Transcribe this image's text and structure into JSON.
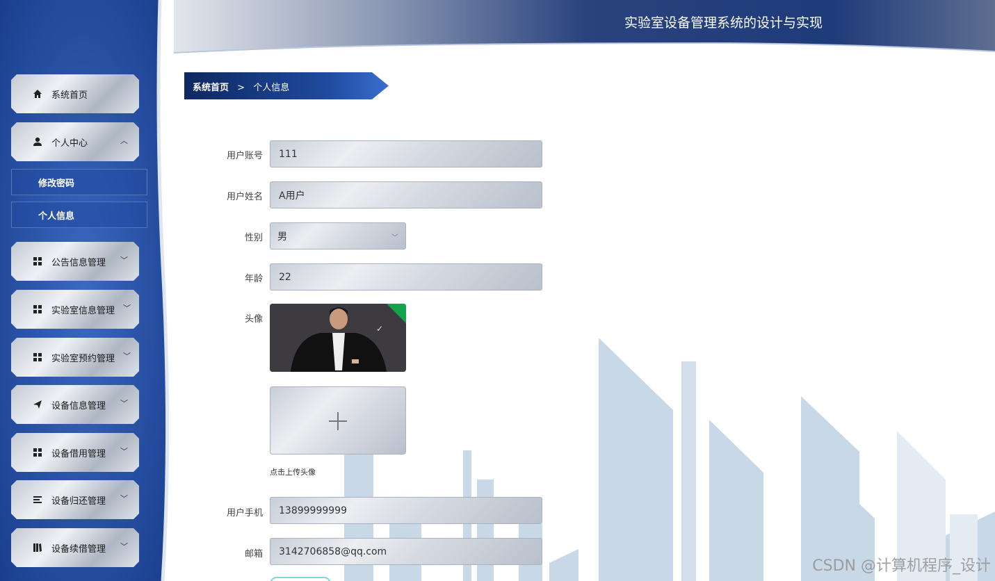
{
  "app": {
    "title": "实验室设备管理系统的设计与实现"
  },
  "breadcrumb": {
    "home": "系统首页",
    "separator": ">",
    "current": "个人信息"
  },
  "sidebar": {
    "items": [
      {
        "label": "系统首页",
        "icon": "home-icon"
      },
      {
        "label": "个人中心",
        "icon": "user-icon",
        "expanded": true
      },
      {
        "label": "公告信息管理",
        "icon": "grid-icon"
      },
      {
        "label": "实验室信息管理",
        "icon": "grid-icon"
      },
      {
        "label": "实验室预约管理",
        "icon": "grid-icon"
      },
      {
        "label": "设备信息管理",
        "icon": "send-icon"
      },
      {
        "label": "设备借用管理",
        "icon": "grid-icon"
      },
      {
        "label": "设备归还管理",
        "icon": "list-icon"
      },
      {
        "label": "设备续借管理",
        "icon": "book-icon"
      }
    ],
    "subitems": [
      {
        "label": "修改密码"
      },
      {
        "label": "个人信息"
      }
    ]
  },
  "form": {
    "account": {
      "label": "用户账号",
      "value": "111"
    },
    "name": {
      "label": "用户姓名",
      "value": "A用户"
    },
    "gender": {
      "label": "性别",
      "value": "男"
    },
    "age": {
      "label": "年龄",
      "value": "22"
    },
    "avatar": {
      "label": "头像"
    },
    "upload_hint": "点击上传头像",
    "phone": {
      "label": "用户手机",
      "value": "13899999999"
    },
    "email": {
      "label": "邮箱",
      "value": "3142706858@qq.com"
    }
  },
  "watermark": "CSDN @计算机程序_设计",
  "colors": {
    "sidebar": "#1e4a9e",
    "header_dark": "#1f3a78",
    "accent_green": "#12a34d"
  }
}
